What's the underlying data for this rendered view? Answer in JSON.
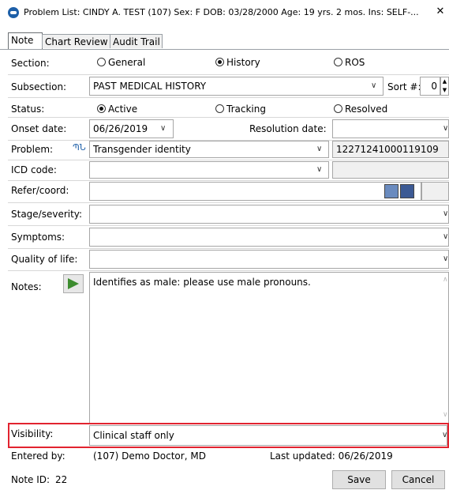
{
  "window": {
    "title": "Problem List: CINDY A. TEST (107)  Sex: F  DOB: 03/28/2000  Age: 19 yrs. 2 mos.  Ins: SELF-...",
    "close_glyph": "✕"
  },
  "tabs": [
    {
      "label": "Note"
    },
    {
      "label": "Chart Review"
    },
    {
      "label": "Audit Trail"
    }
  ],
  "form": {
    "section": {
      "label": "Section:",
      "options": [
        "General",
        "History",
        "ROS"
      ],
      "selected": "History"
    },
    "subsection": {
      "label": "Subsection:",
      "value": "PAST MEDICAL HISTORY",
      "sort_label": "Sort #:",
      "sort_value": "0"
    },
    "status": {
      "label": "Status:",
      "options": [
        "Active",
        "Tracking",
        "Resolved"
      ],
      "selected": "Active"
    },
    "onset": {
      "label": "Onset date:",
      "value": "06/26/2019",
      "resolution_label": "Resolution date:",
      "resolution_value": ""
    },
    "problem": {
      "label": "Problem:",
      "value": "Transgender identity",
      "code": "12271241000119109"
    },
    "icd": {
      "label": "ICD code:",
      "value": ""
    },
    "refer": {
      "label": "Refer/coord:",
      "value": ""
    },
    "stage": {
      "label": "Stage/severity:",
      "value": ""
    },
    "symptoms": {
      "label": "Symptoms:",
      "value": ""
    },
    "quality": {
      "label": "Quality of life:",
      "value": ""
    },
    "notes": {
      "label": "Notes:",
      "value": "Identifies as male: please use male pronouns."
    },
    "visibility": {
      "label": "Visibility:",
      "value": "Clinical staff only"
    }
  },
  "footer": {
    "entered_by_label": "Entered by:",
    "entered_by_value": "(107) Demo Doctor, MD",
    "last_updated": "Last updated: 06/26/2019",
    "note_id_label": "Note ID:",
    "note_id_value": "22",
    "save_label": "Save",
    "cancel_label": "Cancel"
  },
  "colors": {
    "highlight": "#e2232f",
    "app_icon": "#1d5fa8"
  }
}
